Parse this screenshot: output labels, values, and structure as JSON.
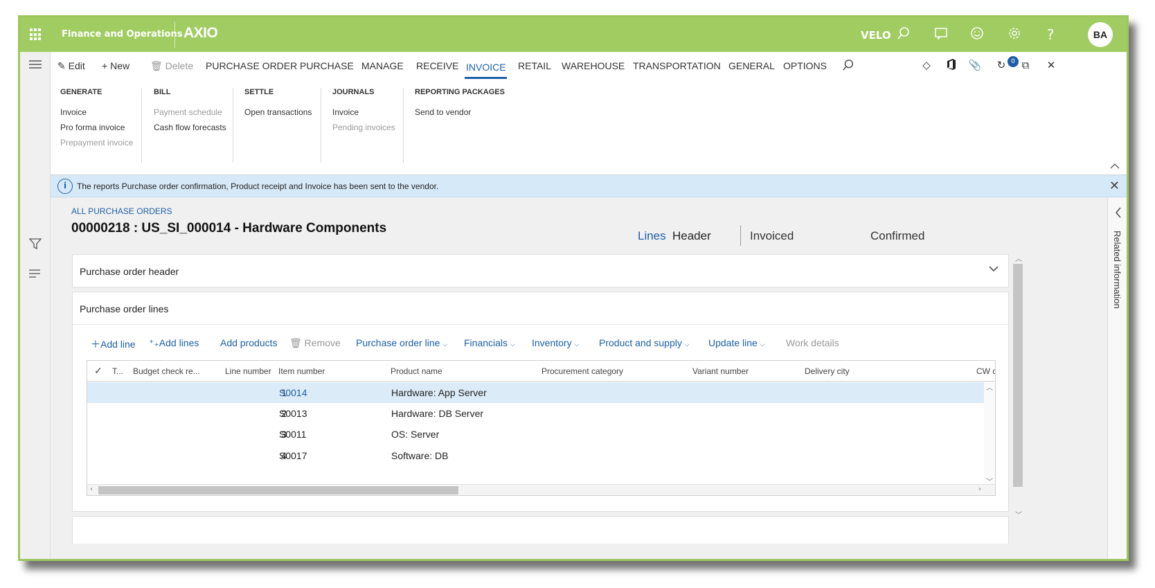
{
  "topbar": {
    "app_name": "Finance and Operations",
    "brand": "AXIO",
    "company": "VELO",
    "icons": [
      "search-icon",
      "chat-icon",
      "smiley-icon",
      "gear-icon",
      "help-icon"
    ],
    "avatar": "BA"
  },
  "action_pane": {
    "edit": "Edit",
    "new": "New",
    "delete": "Delete",
    "tabs": [
      "PURCHASE ORDER",
      "PURCHASE",
      "MANAGE",
      "RECEIVE",
      "INVOICE",
      "RETAIL",
      "WAREHOUSE",
      "TRANSPORTATION",
      "GENERAL",
      "OPTIONS"
    ],
    "active_tab": "INVOICE",
    "attachment_count": "0",
    "groups": [
      {
        "title": "GENERATE",
        "items": [
          {
            "label": "Invoice",
            "disabled": false
          },
          {
            "label": "Pro forma invoice",
            "disabled": false
          },
          {
            "label": "Prepayment invoice",
            "disabled": true
          }
        ]
      },
      {
        "title": "BILL",
        "items": [
          {
            "label": "Payment schedule",
            "disabled": true
          },
          {
            "label": "Cash flow forecasts",
            "disabled": false
          }
        ]
      },
      {
        "title": "SETTLE",
        "items": [
          {
            "label": "Open transactions",
            "disabled": false
          }
        ]
      },
      {
        "title": "JOURNALS",
        "items": [
          {
            "label": "Invoice",
            "disabled": false
          },
          {
            "label": "Pending invoices",
            "disabled": true
          }
        ]
      },
      {
        "title": "REPORTING PACKAGES",
        "items": [
          {
            "label": "Send to vendor",
            "disabled": false
          }
        ]
      }
    ]
  },
  "message_bar": {
    "text": "The reports Purchase order confirmation, Product receipt and Invoice has been sent to the vendor."
  },
  "page": {
    "breadcrumb": "ALL PURCHASE ORDERS",
    "title": "00000218 : US_SI_000014 - Hardware Components",
    "view_lines": "Lines",
    "view_header": "Header",
    "status_invoiced": "Invoiced",
    "status_confirmed": "Confirmed"
  },
  "right_pane": {
    "label": "Related information"
  },
  "header_fasttab": {
    "title": "Purchase order header"
  },
  "lines_fasttab": {
    "title": "Purchase order lines",
    "toolbar": {
      "add_line": "Add line",
      "add_lines": "Add lines",
      "add_products": "Add products",
      "remove": "Remove",
      "purchase_order_line": "Purchase order line",
      "financials": "Financials",
      "inventory": "Inventory",
      "product_and_supply": "Product and supply",
      "update_line": "Update line",
      "work_details": "Work details"
    },
    "columns": [
      "T...",
      "Budget check re...",
      "Line number",
      "Item number",
      "Product name",
      "Procurement category",
      "Variant number",
      "Delivery city",
      "CW q"
    ],
    "rows": [
      {
        "line": "1",
        "item": "S0014",
        "product": "Hardware: App Server",
        "selected": true
      },
      {
        "line": "2",
        "item": "S0013",
        "product": "Hardware: DB Server",
        "selected": false
      },
      {
        "line": "3",
        "item": "S0011",
        "product": "OS: Server",
        "selected": false
      },
      {
        "line": "4",
        "item": "S0017",
        "product": "Software: DB",
        "selected": false
      }
    ]
  },
  "colors": {
    "brand_green": "#a0cc61",
    "accent_blue": "#1d5fa7",
    "info_bar": "#d6e9f8",
    "selected_row": "#dcebf8"
  }
}
